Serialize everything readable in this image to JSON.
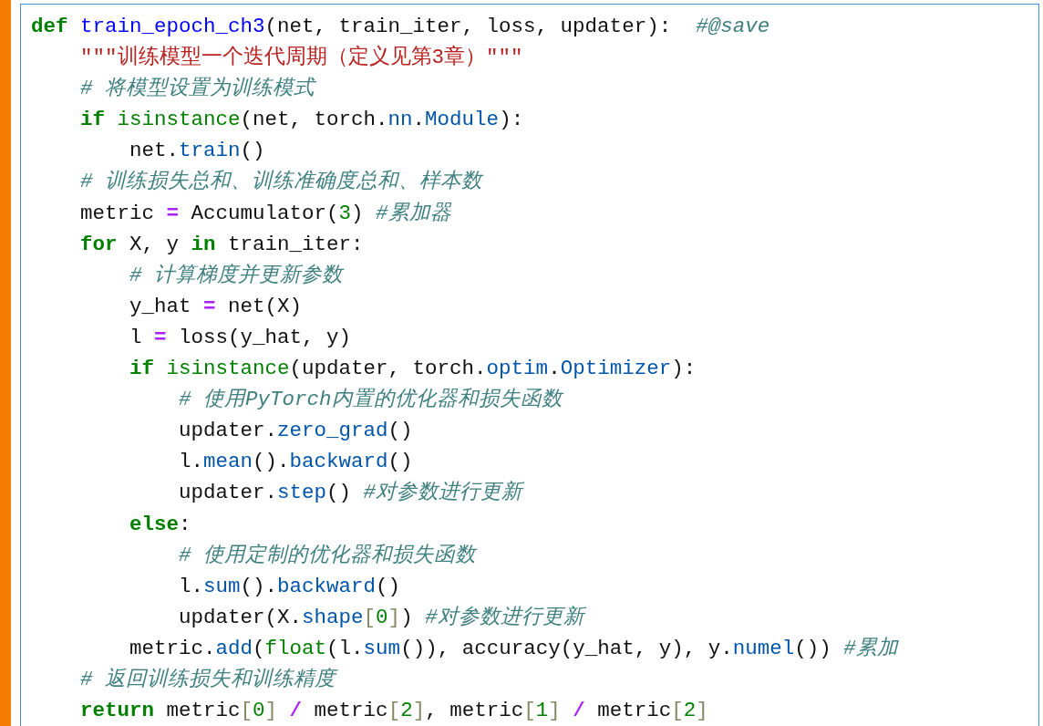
{
  "cell": {
    "lines": [
      [
        {
          "kind": "keyword",
          "text": "def"
        },
        {
          "kind": "function",
          "text": " train_epoch_ch3"
        },
        {
          "kind": "plain",
          "text": "(net, train_iter, loss, updater):  "
        },
        {
          "kind": "comment",
          "text": "#@save"
        }
      ],
      [
        {
          "kind": "string",
          "text": "    \"\"\"训练模型一个迭代周期（定义见第3章）\"\"\""
        }
      ],
      [
        {
          "kind": "comment",
          "text": "    # 将模型设置为训练模式"
        }
      ],
      [
        {
          "kind": "keyword",
          "text": "    if"
        },
        {
          "kind": "builtin",
          "text": " isinstance"
        },
        {
          "kind": "plain",
          "text": "(net, torch."
        },
        {
          "kind": "attribute",
          "text": "nn"
        },
        {
          "kind": "plain",
          "text": "."
        },
        {
          "kind": "attribute",
          "text": "Module"
        },
        {
          "kind": "plain",
          "text": "):"
        }
      ],
      [
        {
          "kind": "plain",
          "text": "        net."
        },
        {
          "kind": "attribute",
          "text": "train"
        },
        {
          "kind": "plain",
          "text": "()"
        }
      ],
      [
        {
          "kind": "comment",
          "text": "    # 训练损失总和、训练准确度总和、样本数"
        }
      ],
      [
        {
          "kind": "plain",
          "text": "    metric "
        },
        {
          "kind": "operator",
          "text": "="
        },
        {
          "kind": "plain",
          "text": " Accumulator("
        },
        {
          "kind": "number",
          "text": "3"
        },
        {
          "kind": "plain",
          "text": ") "
        },
        {
          "kind": "comment",
          "text": "#累加器"
        }
      ],
      [
        {
          "kind": "keyword",
          "text": "    for"
        },
        {
          "kind": "plain",
          "text": " X, y "
        },
        {
          "kind": "keyword",
          "text": "in"
        },
        {
          "kind": "plain",
          "text": " train_iter:"
        }
      ],
      [
        {
          "kind": "comment",
          "text": "        # 计算梯度并更新参数"
        }
      ],
      [
        {
          "kind": "plain",
          "text": "        y_hat "
        },
        {
          "kind": "operator",
          "text": "="
        },
        {
          "kind": "plain",
          "text": " net(X)"
        }
      ],
      [
        {
          "kind": "plain",
          "text": "        l "
        },
        {
          "kind": "operator",
          "text": "="
        },
        {
          "kind": "plain",
          "text": " loss(y_hat, y)"
        }
      ],
      [
        {
          "kind": "keyword",
          "text": "        if"
        },
        {
          "kind": "builtin",
          "text": " isinstance"
        },
        {
          "kind": "plain",
          "text": "(updater, torch."
        },
        {
          "kind": "attribute",
          "text": "optim"
        },
        {
          "kind": "plain",
          "text": "."
        },
        {
          "kind": "attribute",
          "text": "Optimizer"
        },
        {
          "kind": "plain",
          "text": "):"
        }
      ],
      [
        {
          "kind": "comment",
          "text": "            # 使用PyTorch内置的优化器和损失函数"
        }
      ],
      [
        {
          "kind": "plain",
          "text": "            updater."
        },
        {
          "kind": "attribute",
          "text": "zero_grad"
        },
        {
          "kind": "plain",
          "text": "()"
        }
      ],
      [
        {
          "kind": "plain",
          "text": "            l."
        },
        {
          "kind": "attribute",
          "text": "mean"
        },
        {
          "kind": "plain",
          "text": "()."
        },
        {
          "kind": "attribute",
          "text": "backward"
        },
        {
          "kind": "plain",
          "text": "()"
        }
      ],
      [
        {
          "kind": "plain",
          "text": "            updater."
        },
        {
          "kind": "attribute",
          "text": "step"
        },
        {
          "kind": "plain",
          "text": "() "
        },
        {
          "kind": "comment",
          "text": "#对参数进行更新"
        }
      ],
      [
        {
          "kind": "keyword",
          "text": "        else"
        },
        {
          "kind": "plain",
          "text": ":"
        }
      ],
      [
        {
          "kind": "comment",
          "text": "            # 使用定制的优化器和损失函数"
        }
      ],
      [
        {
          "kind": "plain",
          "text": "            l."
        },
        {
          "kind": "attribute",
          "text": "sum"
        },
        {
          "kind": "plain",
          "text": "()."
        },
        {
          "kind": "attribute",
          "text": "backward"
        },
        {
          "kind": "plain",
          "text": "()"
        }
      ],
      [
        {
          "kind": "plain",
          "text": "            updater(X."
        },
        {
          "kind": "attribute",
          "text": "shape"
        },
        {
          "kind": "bracket",
          "text": "["
        },
        {
          "kind": "number",
          "text": "0"
        },
        {
          "kind": "bracket",
          "text": "]"
        },
        {
          "kind": "plain",
          "text": ") "
        },
        {
          "kind": "comment",
          "text": "#对参数进行更新"
        }
      ],
      [
        {
          "kind": "plain",
          "text": "        metric."
        },
        {
          "kind": "attribute",
          "text": "add"
        },
        {
          "kind": "plain",
          "text": "("
        },
        {
          "kind": "builtin",
          "text": "float"
        },
        {
          "kind": "plain",
          "text": "(l."
        },
        {
          "kind": "attribute",
          "text": "sum"
        },
        {
          "kind": "plain",
          "text": "()), accuracy(y_hat, y), y."
        },
        {
          "kind": "attribute",
          "text": "numel"
        },
        {
          "kind": "plain",
          "text": "()) "
        },
        {
          "kind": "comment",
          "text": "#累加"
        }
      ],
      [
        {
          "kind": "comment",
          "text": "    # 返回训练损失和训练精度"
        }
      ],
      [
        {
          "kind": "keyword",
          "text": "    return"
        },
        {
          "kind": "plain",
          "text": " metric"
        },
        {
          "kind": "bracket",
          "text": "["
        },
        {
          "kind": "number",
          "text": "0"
        },
        {
          "kind": "bracket",
          "text": "] "
        },
        {
          "kind": "operator",
          "text": "/"
        },
        {
          "kind": "plain",
          "text": " metric"
        },
        {
          "kind": "bracket",
          "text": "["
        },
        {
          "kind": "number",
          "text": "2"
        },
        {
          "kind": "bracket",
          "text": "]"
        },
        {
          "kind": "plain",
          "text": ", metric"
        },
        {
          "kind": "bracket",
          "text": "["
        },
        {
          "kind": "number",
          "text": "1"
        },
        {
          "kind": "bracket",
          "text": "] "
        },
        {
          "kind": "operator",
          "text": "/"
        },
        {
          "kind": "plain",
          "text": " metric"
        },
        {
          "kind": "bracket",
          "text": "["
        },
        {
          "kind": "number",
          "text": "2"
        },
        {
          "kind": "bracket",
          "text": "]"
        }
      ]
    ]
  }
}
